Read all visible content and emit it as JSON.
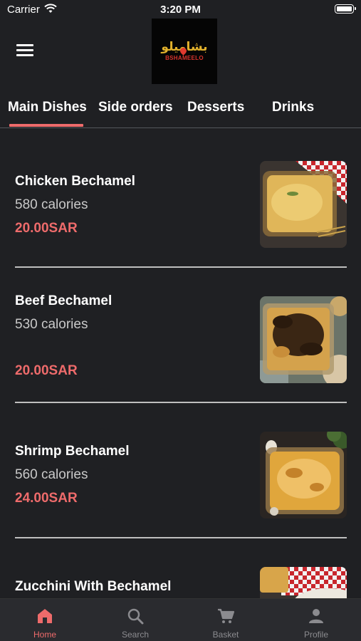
{
  "status_bar": {
    "carrier": "Carrier",
    "time": "3:20 PM"
  },
  "header": {
    "logo_arabic": "بشاميلو",
    "logo_latin": "BSHAMEELO"
  },
  "tabs": [
    {
      "label": "Main Dishes",
      "active": true
    },
    {
      "label": "Side orders"
    },
    {
      "label": "Desserts"
    },
    {
      "label": "Drinks"
    }
  ],
  "dishes": [
    {
      "name": "Chicken Bechamel",
      "calories": "580 calories",
      "price": "20.00SAR"
    },
    {
      "name": "Beef Bechamel",
      "calories": "530 calories",
      "price": "20.00SAR"
    },
    {
      "name": "Shrimp Bechamel",
      "calories": "560 calories",
      "price": "24.00SAR"
    },
    {
      "name": "Zucchini With Bechamel",
      "calories": "",
      "price": ""
    }
  ],
  "bottom_nav": [
    {
      "label": "Home",
      "icon": "home-icon",
      "active": true
    },
    {
      "label": "Search",
      "icon": "search-icon"
    },
    {
      "label": "Basket",
      "icon": "cart-icon"
    },
    {
      "label": "Profile",
      "icon": "profile-icon"
    }
  ],
  "colors": {
    "background": "#1f2023",
    "accent": "#ee6b6b",
    "nav_background": "#2a2b2f"
  }
}
